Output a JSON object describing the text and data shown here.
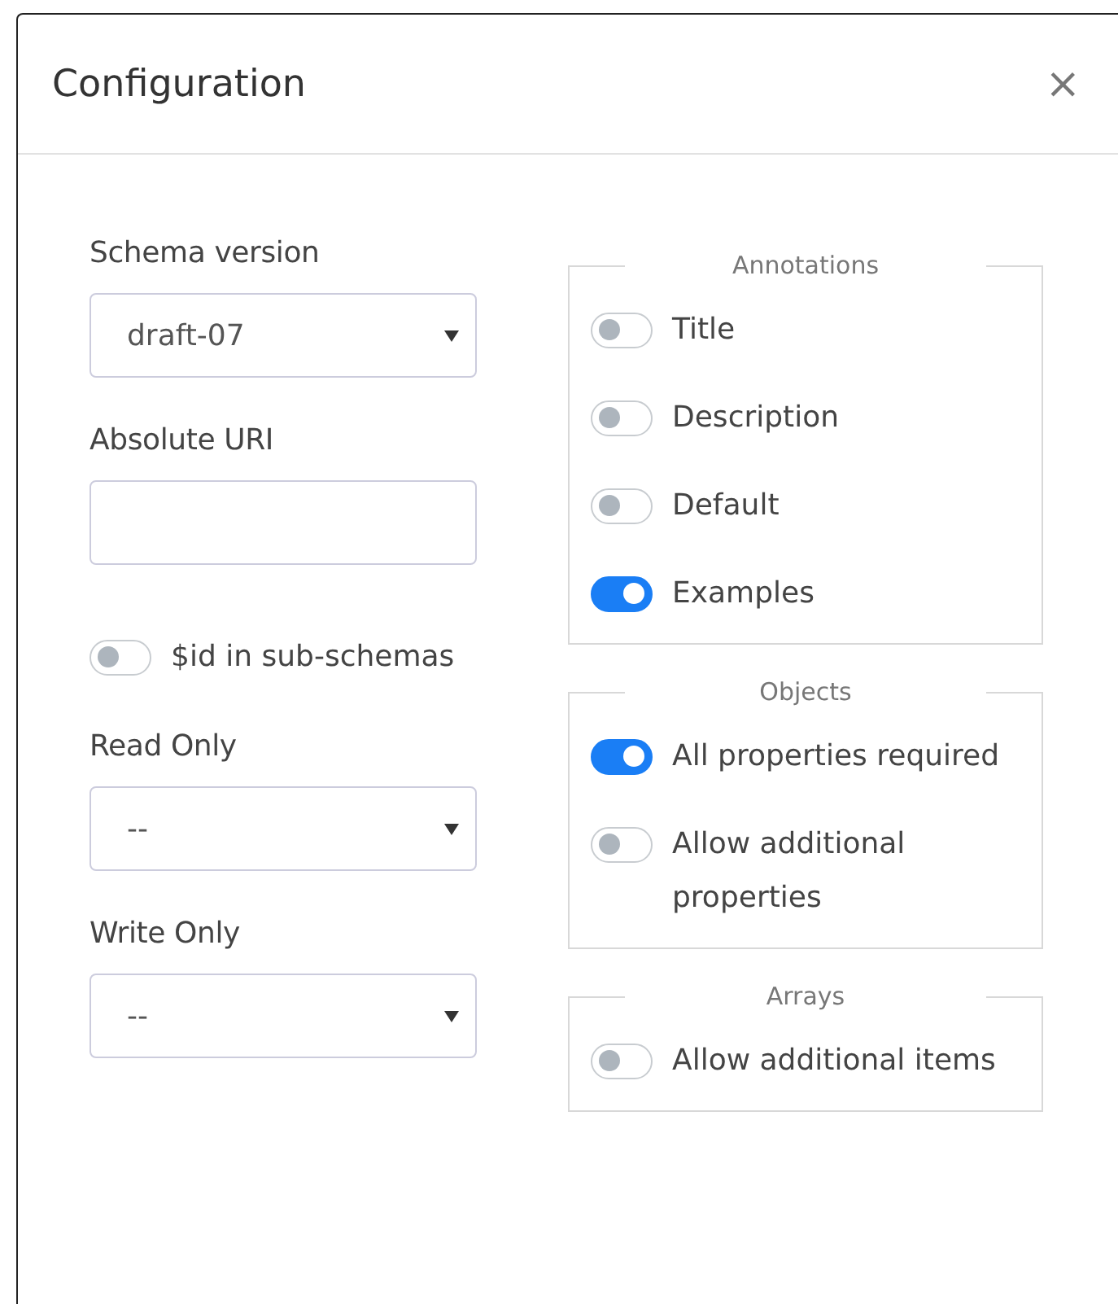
{
  "dialog": {
    "title": "Configuration",
    "close": "×"
  },
  "left": [
    {
      "kind": "select",
      "label": "Schema version",
      "value": "draft-07"
    },
    {
      "kind": "input",
      "label": "Absolute URI"
    },
    {
      "kind": "toggle",
      "label": "$id in sub-schemas",
      "on": false
    },
    {
      "kind": "select",
      "label": "Read Only",
      "value": "--"
    },
    {
      "kind": "select",
      "label": "Write Only",
      "value": "--"
    }
  ],
  "groups": [
    {
      "legend": "Annotations",
      "items": [
        {
          "label": "Title",
          "on": false
        },
        {
          "label": "Description",
          "on": false
        },
        {
          "label": "Default",
          "on": false
        },
        {
          "label": "Examples",
          "on": true
        }
      ]
    },
    {
      "legend": "Objects",
      "items": [
        {
          "label": "All properties required",
          "on": true
        },
        {
          "label": "Allow additional properties",
          "on": false
        }
      ]
    },
    {
      "legend": "Arrays",
      "items": [
        {
          "label": "Allow additional items",
          "on": false
        }
      ]
    }
  ]
}
